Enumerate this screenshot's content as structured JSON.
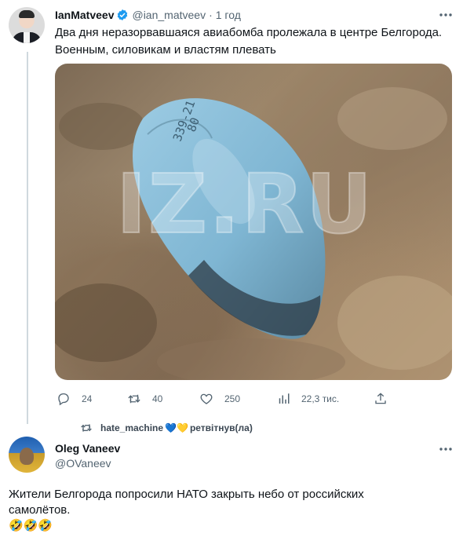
{
  "tweet": {
    "author_name": "IanMatveev",
    "handle": "@ian_matveev",
    "separator": "·",
    "time": "1 год",
    "text_lines": [
      "Два дня неразорвавшаяся авиабомба пролежала в центре Белгорода.",
      "Военным, силовикам и властям плевать"
    ],
    "image": {
      "watermark": "IZ.RU",
      "marking_1": "339-21",
      "marking_2": "80"
    },
    "actions": {
      "replies": "24",
      "retweets": "40",
      "likes": "250",
      "views": "22,3 тис."
    },
    "icons": {
      "verified": "verified-badge-icon",
      "more": "more-options-icon",
      "reply": "reply-icon",
      "retweet": "retweet-icon",
      "like": "heart-icon",
      "views": "analytics-icon",
      "share": "share-icon"
    }
  },
  "retweet_note": {
    "user": "hate_machine",
    "hearts": "💙💛",
    "text": "ретвітнув(ла)"
  },
  "reply": {
    "author_name": "Oleg Vaneev",
    "handle": "@OVaneev",
    "text_lines": [
      "Жители Белгорода попросили НАТО закрыть небо от российских",
      "самолётов.",
      "🤣🤣🤣"
    ]
  },
  "colors": {
    "text_primary": "#0f1419",
    "text_secondary": "#536471",
    "verified": "#1d9bf0",
    "thread_line": "#cfd9de",
    "bomb_blue": "#7fb6d3"
  }
}
